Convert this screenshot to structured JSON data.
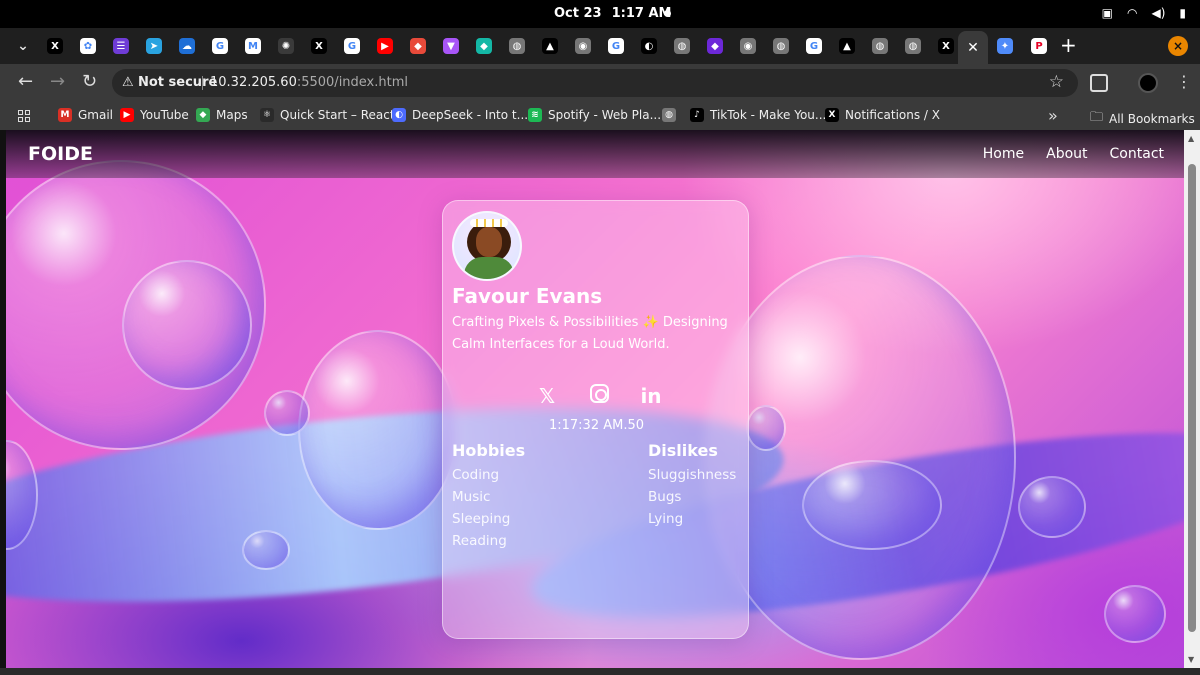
{
  "system": {
    "date": "Oct 23",
    "time": "1:17 AM"
  },
  "tabs": [
    {
      "icon": "x-icon",
      "glyph": "X",
      "color": "#000000"
    },
    {
      "icon": "pinwheel-icon",
      "glyph": "✿",
      "color": "#ffffff"
    },
    {
      "icon": "list-icon",
      "glyph": "☰",
      "color": "#6f3cd6"
    },
    {
      "icon": "telegram-icon",
      "glyph": "➤",
      "color": "#2aa3e0"
    },
    {
      "icon": "onedrive-icon",
      "glyph": "☁",
      "color": "#1f6fd6"
    },
    {
      "icon": "google-icon",
      "glyph": "G",
      "color": "#ffffff"
    },
    {
      "icon": "gmail-icon",
      "glyph": "M",
      "color": "#ffffff"
    },
    {
      "icon": "chatgpt-icon",
      "glyph": "✺",
      "color": "#3a3a3a"
    },
    {
      "icon": "x-icon",
      "glyph": "X",
      "color": "#000000"
    },
    {
      "icon": "google-icon",
      "glyph": "G",
      "color": "#ffffff"
    },
    {
      "icon": "youtube-icon",
      "glyph": "▶",
      "color": "#ff0000"
    },
    {
      "icon": "cube-icon",
      "glyph": "◆",
      "color": "#e84a3a"
    },
    {
      "icon": "vite-icon",
      "glyph": "▼",
      "color": "#a855f7"
    },
    {
      "icon": "diamond-icon",
      "glyph": "◆",
      "color": "#14b8a6"
    },
    {
      "icon": "globe-icon",
      "glyph": "◍",
      "color": "#777777"
    },
    {
      "icon": "triangle-icon",
      "glyph": "▲",
      "color": "#000000"
    },
    {
      "icon": "chrome-icon",
      "glyph": "◉",
      "color": "#777777"
    },
    {
      "icon": "google-icon",
      "glyph": "G",
      "color": "#ffffff"
    },
    {
      "icon": "github-icon",
      "glyph": "◐",
      "color": "#000000"
    },
    {
      "icon": "globe-icon",
      "glyph": "◍",
      "color": "#777777"
    },
    {
      "icon": "purple-icon",
      "glyph": "◆",
      "color": "#6d28d9"
    },
    {
      "icon": "chrome-icon",
      "glyph": "◉",
      "color": "#777777"
    },
    {
      "icon": "globe-icon",
      "glyph": "◍",
      "color": "#777777"
    },
    {
      "icon": "google-icon",
      "glyph": "G",
      "color": "#ffffff"
    },
    {
      "icon": "triangle-icon",
      "glyph": "▲",
      "color": "#000000"
    },
    {
      "icon": "globe-icon",
      "glyph": "◍",
      "color": "#777777"
    },
    {
      "icon": "globe-icon",
      "glyph": "◍",
      "color": "#777777"
    },
    {
      "icon": "x-icon",
      "glyph": "X",
      "color": "#000000"
    }
  ],
  "active_tab_close": "✕",
  "extra_tabs": [
    {
      "icon": "gemini-icon",
      "glyph": "✦",
      "color": "#4f8bf9"
    },
    {
      "icon": "pinterest-icon",
      "glyph": "P",
      "color": "#ffffff"
    }
  ],
  "address": {
    "not_secure": "Not secure",
    "host": "10.32.205.60",
    "path": ":5500/index.html"
  },
  "bookmarks": [
    {
      "label": "Gmail",
      "glyph": "M",
      "color": "#d93025"
    },
    {
      "label": "YouTube",
      "glyph": "▶",
      "color": "#ff0000"
    },
    {
      "label": "Maps",
      "glyph": "◆",
      "color": "#34a853"
    },
    {
      "label": "Quick Start – React",
      "glyph": "⚛",
      "color": "#2a2a2a"
    },
    {
      "label": "DeepSeek - Into t...",
      "glyph": "◐",
      "color": "#4d6bfe"
    },
    {
      "label": "Spotify - Web Pla...",
      "glyph": "≋",
      "color": "#1db954"
    },
    {
      "label": "",
      "glyph": "◍",
      "color": "#777777"
    },
    {
      "label": "TikTok - Make You...",
      "glyph": "♪",
      "color": "#000000"
    },
    {
      "label": "Notifications / X",
      "glyph": "X",
      "color": "#000000"
    }
  ],
  "all_bookmarks": "All Bookmarks",
  "site": {
    "brand": "FOIDE",
    "nav": [
      "Home",
      "About",
      "Contact"
    ]
  },
  "profile": {
    "name": "Favour Evans",
    "bio": "Crafting Pixels & Possibilities ✨ Designing Calm Interfaces for a Loud World.",
    "socials": {
      "x": "𝕏",
      "linkedin": "in"
    },
    "time": "1:17:32 AM.50",
    "hobbies_title": "Hobbies",
    "hobbies": [
      "Coding",
      "Music",
      "Sleeping",
      "Reading"
    ],
    "dislikes_title": "Dislikes",
    "dislikes": [
      "Sluggishness",
      "Bugs",
      "Lying"
    ]
  }
}
